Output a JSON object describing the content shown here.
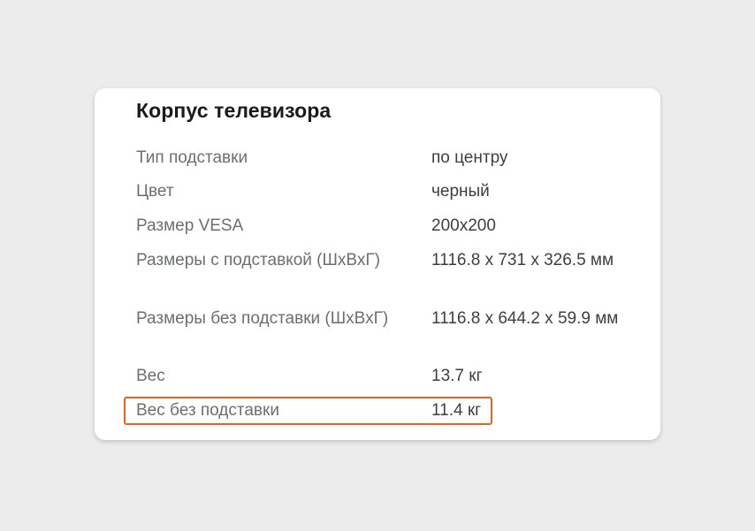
{
  "card": {
    "title": "Корпус телевизора",
    "rows": [
      {
        "label": "Тип подставки",
        "value": "по центру"
      },
      {
        "label": "Цвет",
        "value": "черный"
      },
      {
        "label": "Размер VESA",
        "value": "200x200"
      },
      {
        "label": "Размеры с подставкой (ШхВхГ)",
        "value": "1116.8 x 731 x 326.5 мм"
      },
      {
        "label": "Размеры без подставки (ШхВхГ)",
        "value": "1116.8 x 644.2 x 59.9 мм"
      },
      {
        "label": "Вес",
        "value": "13.7 кг"
      },
      {
        "label": "Вес без подставки",
        "value": "11.4 кг"
      }
    ]
  },
  "colors": {
    "highlight_border": "#e8641e",
    "label_text": "#6b6e72",
    "value_text": "#3c3f43"
  }
}
